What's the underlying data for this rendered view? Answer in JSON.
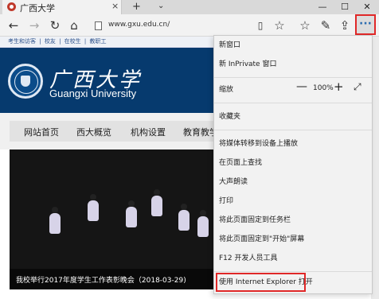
{
  "tab": {
    "title": "广西大学",
    "close": "×"
  },
  "tabbar": {
    "new_tab": "+",
    "chevron": "⌄"
  },
  "window": {
    "minimize": "—",
    "maximize": "☐",
    "close": "✕"
  },
  "nav": {
    "back": "←",
    "forward": "→",
    "refresh": "↻",
    "home": "⌂",
    "url": "www.gxu.edu.cn/",
    "reading_view": "▯",
    "favorite": "☆",
    "favorites_hub": "☆",
    "notes": "✎",
    "share": "⇪",
    "more": "···"
  },
  "site": {
    "toplinks": [
      "考生和访客",
      "|",
      "校友",
      "|",
      "在校生",
      "|",
      "教职工"
    ],
    "name_cn": "广西大学",
    "name_en": "Guangxi University",
    "menu": [
      "网站首页",
      "西大概览",
      "机构设置",
      "教育教学"
    ],
    "caption": "我校举行2017年度学生工作表彰晚会（2018-03-29)"
  },
  "dropdown": {
    "new_window": "新窗口",
    "new_inprivate": "新 InPrivate 窗口",
    "zoom_label": "缩放",
    "zoom_minus": "—",
    "zoom_value": "100%",
    "zoom_plus": "+",
    "zoom_full": "⤢",
    "favorites": "收藏夹",
    "cast": "将媒体转移到设备上播放",
    "find": "在页面上查找",
    "read_aloud": "大声朗读",
    "print": "打印",
    "pin_taskbar": "将此页面固定到任务栏",
    "pin_start": "将此页面固定到\"开始\"屏幕",
    "devtools": "F12 开发人员工具",
    "open_ie": "使用 Internet Explorer 打开"
  },
  "colors": {
    "highlight": "#e02828",
    "banner": "#063a6e",
    "link": "#2a4f8a"
  }
}
